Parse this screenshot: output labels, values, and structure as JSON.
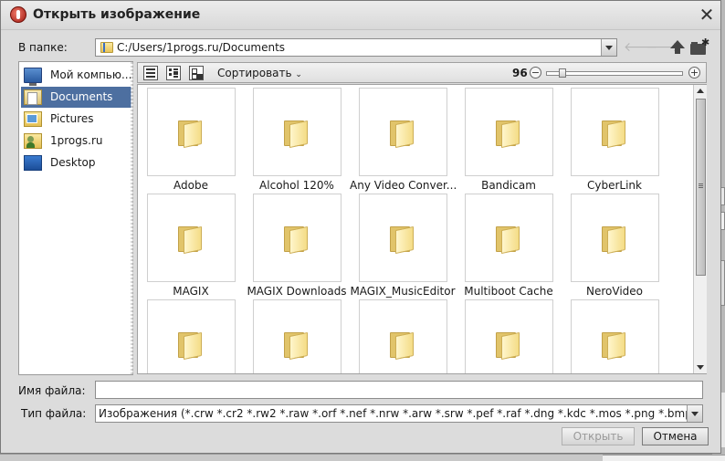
{
  "dialog": {
    "title": "Открыть изображение",
    "close_glyph": "✕"
  },
  "location": {
    "label": "В папке:",
    "path": "C:/Users/1progs.ru/Documents",
    "back_glyph": "🡐",
    "forward_glyph": "🡒"
  },
  "sidebar": {
    "items": [
      {
        "label": "Мой компью...",
        "icon": "computer-icon",
        "selected": false
      },
      {
        "label": "Documents",
        "icon": "documents-folder-icon",
        "selected": true
      },
      {
        "label": "Pictures",
        "icon": "pictures-folder-icon",
        "selected": false
      },
      {
        "label": "1progs.ru",
        "icon": "user-folder-icon",
        "selected": false
      },
      {
        "label": "Desktop",
        "icon": "desktop-icon",
        "selected": false
      }
    ]
  },
  "view": {
    "sort_label": "Сортировать",
    "sort_caret": "⌄",
    "zoom_value": "96",
    "zoom_minus": "−",
    "zoom_plus": "+",
    "zoom_fraction": 0.1
  },
  "files": {
    "items": [
      {
        "name": "Adobe"
      },
      {
        "name": "Alcohol 120%"
      },
      {
        "name": "Any Video Conver..."
      },
      {
        "name": "Bandicam"
      },
      {
        "name": "CyberLink"
      },
      {
        "name": "MAGIX"
      },
      {
        "name": "MAGIX Downloads"
      },
      {
        "name": "MAGIX_MusicEditor"
      },
      {
        "name": "Multiboot Cache"
      },
      {
        "name": "NeroVideo"
      },
      {
        "name": ""
      },
      {
        "name": ""
      },
      {
        "name": ""
      },
      {
        "name": ""
      },
      {
        "name": ""
      }
    ]
  },
  "filename": {
    "label": "Имя файла:",
    "value": ""
  },
  "filetype": {
    "label": "Тип файла:",
    "value": "Изображения (*.crw *.cr2 *.rw2 *.raw *.orf *.nef *.nrw *.arw *.srw *.pef *.raf *.dng *.kdc *.mos *.png *.bmp *.jpg *.jpeg *.tif *.tiff)"
  },
  "buttons": {
    "open": "Открыть",
    "cancel": "Отмена"
  },
  "colors": {
    "selection": "#4d6fa0",
    "dialog_bg": "#dcdcdc"
  }
}
